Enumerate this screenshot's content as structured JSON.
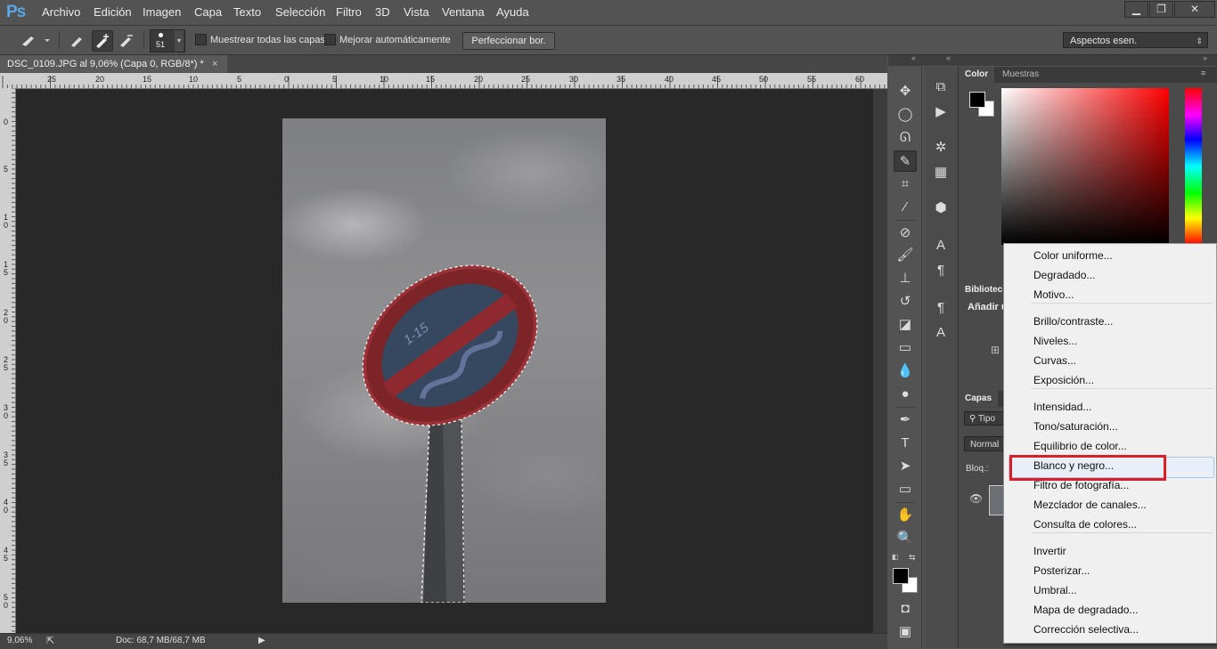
{
  "app": {
    "logo": "Ps"
  },
  "menu": [
    "Archivo",
    "Edición",
    "Imagen",
    "Capa",
    "Texto",
    "Selección",
    "Filtro",
    "3D",
    "Vista",
    "Ventana",
    "Ayuda"
  ],
  "window_controls": {
    "minimize": "▁",
    "restore": "❐",
    "close": "✕"
  },
  "options_bar": {
    "brush_size": "51",
    "sample_all_layers": "Muestrear todas las capas",
    "auto_enhance": "Mejorar automáticamente",
    "refine_edge": "Perfeccionar bor.",
    "workspace": "Aspectos esen."
  },
  "document": {
    "tab_title": "DSC_0109.JPG al 9,06% (Capa 0, RGB/8*) *",
    "tab_close": "×",
    "ruler_h": [
      "25",
      "20",
      "15",
      "10",
      "5",
      "0",
      "5",
      "10",
      "15",
      "20",
      "25",
      "30",
      "35",
      "40",
      "45",
      "50",
      "55",
      "60"
    ],
    "ruler_v": [
      "0",
      "5",
      "1\n0",
      "1\n5",
      "2\n0",
      "2\n5",
      "3\n0",
      "3\n5",
      "4\n0",
      "4\n5",
      "5\n0"
    ],
    "sign_text": "1-15"
  },
  "status_bar": {
    "zoom": "9,06%",
    "doc_size": "Doc: 68,7 MB/68,7 MB"
  },
  "panels": {
    "color_tabs": [
      "Color",
      "Muestras"
    ],
    "libraries_tab": "Bibliotec",
    "libraries_add": "Añadir u",
    "layers_tab": "Capas",
    "layers_filter": "Tipo",
    "blend_mode": "Normal",
    "lock_label": "Bloq.:"
  },
  "context_menu": {
    "items": [
      "Color uniforme...",
      "Degradado...",
      "Motivo...",
      "Brillo/contraste...",
      "Niveles...",
      "Curvas...",
      "Exposición...",
      "Intensidad...",
      "Tono/saturación...",
      "Equilibrio de color...",
      "Blanco y negro...",
      "Filtro de fotografía...",
      "Mezclador de canales...",
      "Consulta de colores...",
      "Invertir",
      "Posterizar...",
      "Umbral...",
      "Mapa de degradado...",
      "Corrección selectiva..."
    ],
    "highlighted": "Blanco y negro...",
    "highlight_color": "#dc1f26"
  },
  "icons": {
    "toolbar": [
      "move-icon",
      "marquee-icon",
      "lasso-icon",
      "quick-selection-icon",
      "crop-icon",
      "eyedropper-icon",
      "healing-icon",
      "brush-icon",
      "stamp-icon",
      "history-brush-icon",
      "eraser-icon",
      "gradient-icon",
      "blur-icon",
      "dodge-icon",
      "pen-icon",
      "type-icon",
      "path-select-icon",
      "shape-icon",
      "hand-icon",
      "zoom-icon"
    ]
  }
}
